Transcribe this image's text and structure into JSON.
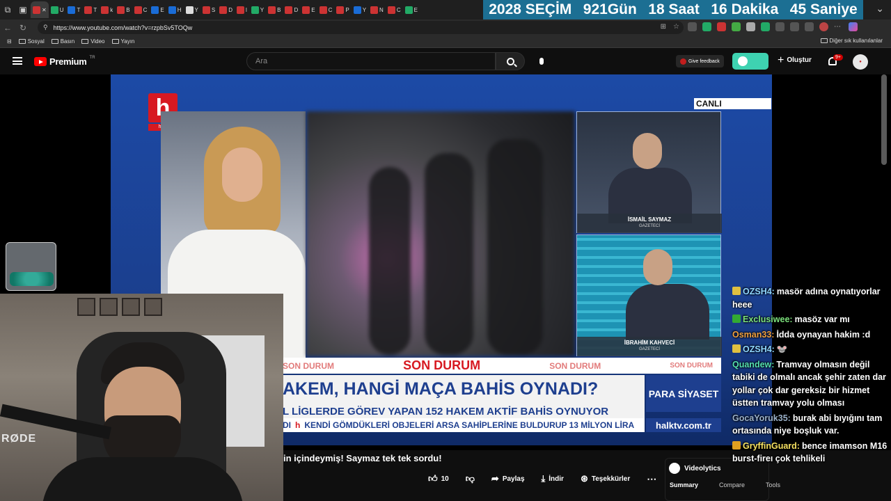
{
  "browser": {
    "tabs": [
      {
        "label": "U",
        "color": "#2a6"
      },
      {
        "label": "T",
        "color": "#1a6cd6"
      },
      {
        "label": "T",
        "color": "#c33"
      },
      {
        "label": "k",
        "color": "#c33"
      },
      {
        "label": "B",
        "color": "#c33"
      },
      {
        "label": "C",
        "color": "#c33"
      },
      {
        "label": "E",
        "color": "#1a6cd6"
      },
      {
        "label": "H",
        "color": "#1a6cd6"
      },
      {
        "label": "Y",
        "color": "#ddd"
      },
      {
        "label": "S",
        "color": "#c33"
      },
      {
        "label": "D",
        "color": "#c33"
      },
      {
        "label": "l",
        "color": "#c33"
      },
      {
        "label": "Y",
        "color": "#2a6"
      },
      {
        "label": "B",
        "color": "#c33"
      },
      {
        "label": "D",
        "color": "#c33"
      },
      {
        "label": "E",
        "color": "#c33"
      },
      {
        "label": "C",
        "color": "#c33"
      },
      {
        "label": "P",
        "color": "#c33"
      },
      {
        "label": "Y",
        "color": "#1a6cd6"
      },
      {
        "label": "N",
        "color": "#c33"
      },
      {
        "label": "C",
        "color": "#c33"
      },
      {
        "label": "E",
        "color": "#2a6"
      }
    ],
    "countdown": {
      "year": "2028",
      "label": "SEÇİM",
      "days": "921",
      "days_unit": "Gün",
      "hours": "18",
      "hours_unit": "Saat",
      "minutes": "16",
      "minutes_unit": "Dakika",
      "seconds": "45",
      "seconds_unit": "Saniye"
    },
    "url": "https://www.youtube.com/watch?v=rzpbSv5TOQw",
    "bookmarks": [
      "Sosyal",
      "Basın",
      "Video",
      "Yayın"
    ],
    "bookmarks_other": "Diğer sık kullanılanlar"
  },
  "youtube": {
    "logo_text": "Premium",
    "logo_region": "TR",
    "search_placeholder": "Ara",
    "feedback_label": "Give feedback",
    "create_label": "Oluştur",
    "notifications_badge": "9+"
  },
  "video": {
    "channel_logo": "h",
    "channel_logo_sub": "halk",
    "live_label": "CANLI",
    "guest1_name": "İSMAİL SAYMAZ",
    "guest1_role": "GAZETECİ",
    "guest2_name": "İBRAHİM KAHVECİ",
    "guest2_role": "GAZETECİ",
    "breaking_small": "SON DURUM",
    "breaking_main": "SON DURUM",
    "headline": "AKEM, HANGİ MAÇA BAHİS OYNADI?",
    "subheadline": "L LİGLERDE GÖREV YAPAN 152 HAKEM AKTİF BAHİS OYNUYOR",
    "ticker_prefix": "DI",
    "ticker_text": "KENDİ GÖMDÜKLERİ OBJELERİ ARSA SAHİPLERİNE BULDURUP 13 MİLYON LİRA",
    "program": "PARA SİYASET",
    "site": "halktv.com.tr"
  },
  "below": {
    "title": "in içindeymiş! Saymaz tek tek sordu!",
    "likes": "10",
    "share": "Paylaş",
    "download": "İndir",
    "thanks": "Teşekkürler"
  },
  "videolytics": {
    "title": "Videolytics",
    "tab1": "Summary",
    "tab2": "Compare",
    "tab3": "Tools"
  },
  "chat": [
    {
      "user": "OZSH4:",
      "text": "masör adına oynatıyorlar heee",
      "color": "#8fd6ff",
      "badge": "#e0c040"
    },
    {
      "user": "Exclusiwee:",
      "text": "masöz var mı",
      "color": "#7be07b",
      "badge": "#33aa33"
    },
    {
      "user": "Osman33:",
      "text": "İdda oynayan hakim :d",
      "color": "#f0a040",
      "badge": ""
    },
    {
      "user": "OZSH4:",
      "text": "🐭",
      "color": "#8fd6ff",
      "badge": "#e0c040"
    },
    {
      "user": "Quandew:",
      "text": "Tramvay olmasın değil tabiki de olmalı ancak şehir zaten dar yollar çok dar gereksiz bir hizmet üstten tramvay yolu olması",
      "color": "#55e0b0",
      "badge": ""
    },
    {
      "user": "GocaYoruk35:",
      "text": "burak abi bıyığını tam ortasında niye boşluk var.",
      "color": "#9ab0c8",
      "badge": ""
    },
    {
      "user": "GryffinGuard:",
      "text": "bence imamson M16 burst-fireı çok tehlikeli",
      "color": "#f5e060",
      "badge": "#e0a020"
    }
  ]
}
